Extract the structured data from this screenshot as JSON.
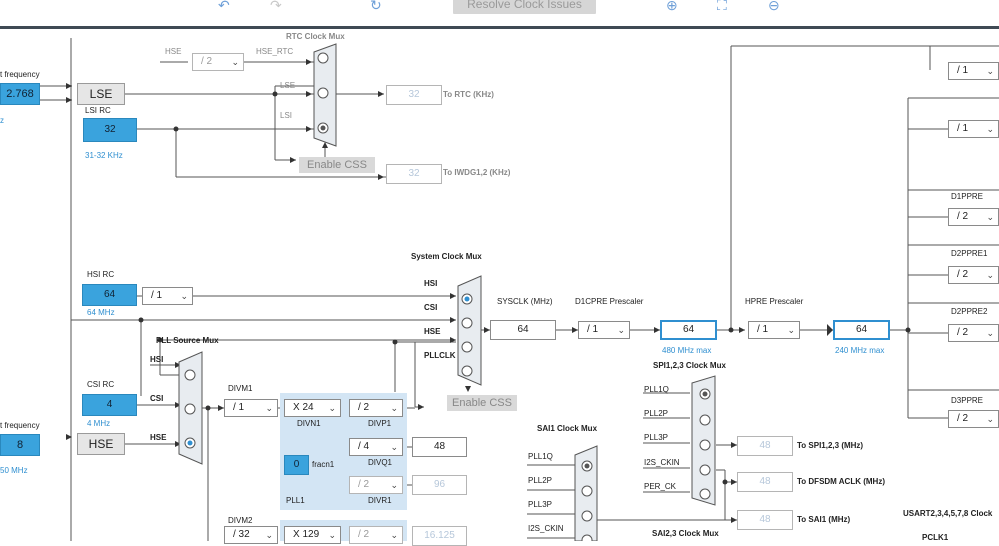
{
  "toolbar": {
    "undo_icon": "undo-icon",
    "redo_icon": "redo-icon",
    "refresh_icon": "refresh-icon",
    "resolve_label": "Resolve Clock Issues",
    "zoom_in_icon": "zoom-in-icon",
    "fit_icon": "fit-icon",
    "zoom_out_icon": "zoom-out-icon"
  },
  "left": {
    "lse_freq_label": "t frequency",
    "lse_value": "2.768",
    "lse_unit": "z",
    "lse_button": "LSE",
    "lsi_label": "LSI RC",
    "lsi_value": "32",
    "lsi_range": "31-32 KHz",
    "hse_freq_label": "t frequency",
    "hse_value": "8",
    "hse_range": "50 MHz",
    "hse_button": "HSE",
    "hsi_label": "HSI RC",
    "hsi_value": "64",
    "hsi_freq": "64 MHz",
    "hsi_div": "/ 1",
    "csi_label": "CSI RC",
    "csi_value": "4",
    "csi_freq": "4 MHz"
  },
  "rtc": {
    "title": "RTC Clock Mux",
    "hse_in": "HSE",
    "hse_div": "/ 2",
    "hse_rtc": "HSE_RTC",
    "lse_in": "LSE",
    "lsi_in": "LSI",
    "enable_css": "Enable CSS",
    "rtc_out": "32",
    "rtc_out_label": "To RTC (KHz)",
    "iwdg_out": "32",
    "iwdg_out_label": "To IWDG1,2 (KHz)"
  },
  "sysmux": {
    "title": "System Clock Mux",
    "hsi": "HSI",
    "csi": "CSI",
    "hse": "HSE",
    "pllclk": "PLLCLK",
    "enable_css": "Enable CSS",
    "sysclk_label": "SYSCLK (MHz)",
    "sysclk_value": "64",
    "d1cpre_label": "D1CPRE Prescaler",
    "d1cpre_div": "/ 1",
    "d1_value": "64",
    "d1_max": "480 MHz max",
    "hpre_label": "HPRE Prescaler",
    "hpre_div": "/ 1",
    "hpre_value": "64",
    "hpre_max": "240 MHz max"
  },
  "pll": {
    "source_title": "PLL Source Mux",
    "hsi": "HSI",
    "csi": "CSI",
    "hse": "HSE",
    "divm1_label": "DIVM1",
    "divm1": "/ 1",
    "divn1": "X 24",
    "divn1_label": "DIVN1",
    "divp1": "/ 2",
    "divp1_label": "DIVP1",
    "divq1": "/ 4",
    "divq1_label": "DIVQ1",
    "divq1_out": "48",
    "divr1": "/ 2",
    "divr1_label": "DIVR1",
    "divr1_out": "96",
    "fracn1_value": "0",
    "fracn1_label": "fracn1",
    "pll1_label": "PLL1",
    "divm2_label": "DIVM2",
    "divm2": "/ 32",
    "divn2": "X 129",
    "divp2": "/ 2",
    "divp2_out": "16.125"
  },
  "right": {
    "div_top1": "/ 1",
    "div_top2": "/ 1",
    "d1ppre_label": "D1PPRE",
    "d1ppre": "/ 2",
    "d2ppre1_label": "D2PPRE1",
    "d2ppre1": "/ 2",
    "d2ppre2_label": "D2PPRE2",
    "d2ppre2": "/ 2",
    "d3ppre_label": "D3PPRE",
    "d3ppre": "/ 2",
    "usart_label": "USART2,3,4,5,7,8 Clock",
    "pclk1_label": "PCLK1"
  },
  "spi": {
    "title": "SPI1,2,3 Clock Mux",
    "in1": "PLL1Q",
    "in2": "PLL2P",
    "in3": "PLL3P",
    "in4": "I2S_CKIN",
    "in5": "PER_CK",
    "out_spi": "48",
    "out_spi_label": "To SPI1,2,3 (MHz)",
    "out_dfsdm": "48",
    "out_dfsdm_label": "To DFSDM ACLK (MHz)",
    "out_sai": "48",
    "out_sai_label": "To SAI1 (MHz)"
  },
  "sai": {
    "title": "SAI1 Clock Mux",
    "in1": "PLL1Q",
    "in2": "PLL2P",
    "in3": "PLL3P",
    "in4": "I2S_CKIN",
    "sai23_title": "SAI2,3 Clock Mux"
  },
  "colors": {
    "accent_blue": "#3aa3dd",
    "active_border": "#2f8fd0",
    "pll_panel": "#d3e5f4"
  }
}
